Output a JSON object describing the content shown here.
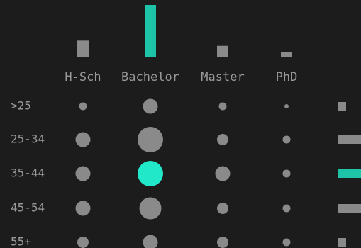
{
  "chart_data": {
    "type": "scatter",
    "subtype": "dot-matrix with marginal bars",
    "columns": [
      "H-Sch",
      "Bachelor",
      "Master",
      "PhD"
    ],
    "rows": [
      ">25",
      "25-34",
      "35-44",
      "45-54",
      "55+"
    ],
    "cells": [
      [
        1,
        3,
        1,
        0
      ],
      [
        3,
        6,
        2,
        1
      ],
      [
        3,
        6,
        3,
        1
      ],
      [
        3,
        5,
        2,
        1
      ],
      [
        2,
        3,
        2,
        1
      ]
    ],
    "highlight": {
      "row": "35-44",
      "column": "Bachelor"
    },
    "column_totals": [
      3.2,
      10,
      2.2,
      1
    ],
    "row_totals": [
      1,
      3.2,
      3.4,
      3.2,
      1.4
    ],
    "grid": false,
    "legend": "none",
    "colors": {
      "background": "#1c1c1c",
      "mark": "#8a8a8a",
      "highlight": "#20e8c8",
      "bar_highlight": "#1ec4a8",
      "label": "#9a9a9a"
    }
  }
}
